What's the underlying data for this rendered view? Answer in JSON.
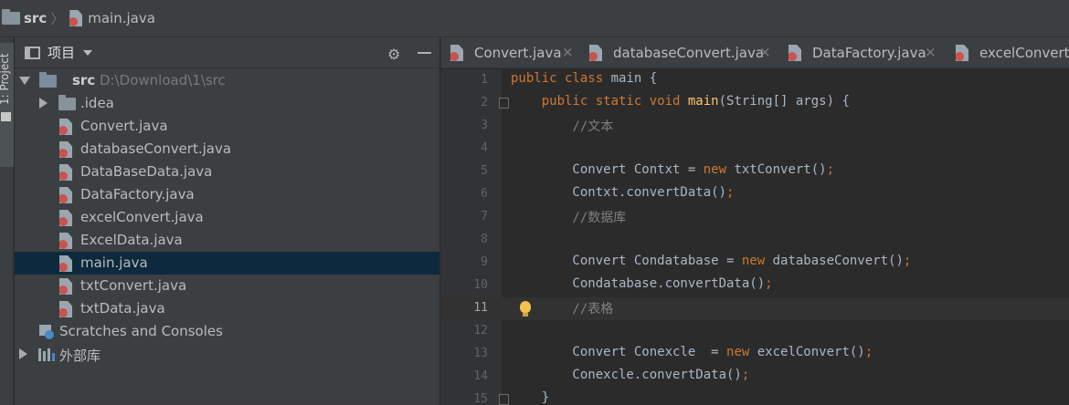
{
  "navbar": {
    "root": "src",
    "file": "main.java"
  },
  "toolstrip": {
    "tab_label": "1: Project"
  },
  "project": {
    "title": "项目",
    "tree": {
      "root_name": "src",
      "root_path": "D:\\Download\\1\\src",
      "idea_folder": ".idea",
      "files": [
        "Convert.java",
        "databaseConvert.java",
        "DataBaseData.java",
        "DataFactory.java",
        "excelConvert.java",
        "ExcelData.java",
        "main.java",
        "txtConvert.java",
        "txtData.java"
      ],
      "selected_file": "main.java",
      "scratches": "Scratches and Consoles",
      "external_libs": "外部库"
    }
  },
  "editor": {
    "tabs": [
      "Convert.java",
      "databaseConvert.java",
      "DataFactory.java",
      "excelConvert.java"
    ],
    "current_line": 11,
    "lines": [
      {
        "n": "1",
        "segs": [
          [
            "kw",
            "public class "
          ],
          [
            "",
            "main {"
          ]
        ]
      },
      {
        "n": "2",
        "segs": [
          [
            "",
            "    "
          ],
          [
            "kw",
            "public static void "
          ],
          [
            "fn",
            "main"
          ],
          [
            "",
            "(String[] args) {"
          ]
        ]
      },
      {
        "n": "3",
        "segs": [
          [
            "cm",
            "        //文本"
          ]
        ]
      },
      {
        "n": "4",
        "segs": []
      },
      {
        "n": "5",
        "segs": [
          [
            "",
            "        Convert Contxt = "
          ],
          [
            "kw",
            "new "
          ],
          [
            "",
            "txtConvert()"
          ],
          [
            "kw",
            ";"
          ]
        ]
      },
      {
        "n": "6",
        "segs": [
          [
            "",
            "        Contxt.convertData()"
          ],
          [
            "kw",
            ";"
          ]
        ]
      },
      {
        "n": "7",
        "segs": [
          [
            "cm",
            "        //数据库"
          ]
        ]
      },
      {
        "n": "8",
        "segs": []
      },
      {
        "n": "9",
        "segs": [
          [
            "",
            "        Convert Condatabase = "
          ],
          [
            "kw",
            "new "
          ],
          [
            "",
            "databaseConvert()"
          ],
          [
            "kw",
            ";"
          ]
        ]
      },
      {
        "n": "10",
        "segs": [
          [
            "",
            "        Condatabase.convertData()"
          ],
          [
            "kw",
            ";"
          ]
        ]
      },
      {
        "n": "11",
        "segs": [
          [
            "cm",
            "        //表格"
          ]
        ]
      },
      {
        "n": "12",
        "segs": []
      },
      {
        "n": "13",
        "segs": [
          [
            "",
            "        Convert Conexcle  = "
          ],
          [
            "kw",
            "new "
          ],
          [
            "",
            "excelConvert()"
          ],
          [
            "kw",
            ";"
          ]
        ]
      },
      {
        "n": "14",
        "segs": [
          [
            "",
            "        Conexcle.convertData()"
          ],
          [
            "kw",
            ";"
          ]
        ]
      },
      {
        "n": "15",
        "segs": [
          [
            "",
            "    }"
          ]
        ]
      }
    ]
  }
}
